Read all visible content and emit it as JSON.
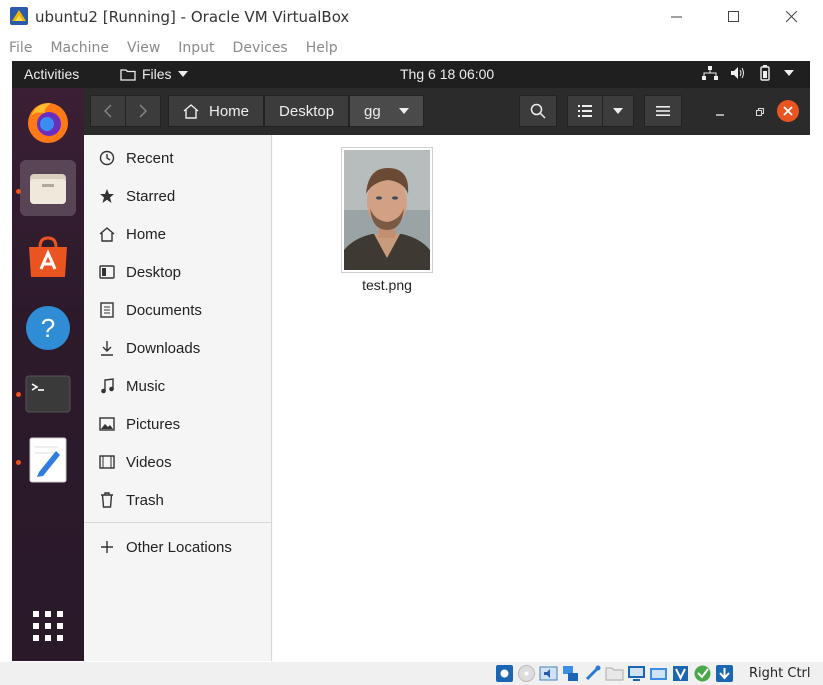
{
  "host": {
    "title": "ubuntu2 [Running] - Oracle VM VirtualBox",
    "menu": [
      "File",
      "Machine",
      "View",
      "Input",
      "Devices",
      "Help"
    ],
    "host_key": "Right Ctrl"
  },
  "ubuntu": {
    "activities": "Activities",
    "app_menu": "Files",
    "clock": "Thg 6 18  06:00"
  },
  "files": {
    "breadcrumbs": [
      "Home",
      "Desktop",
      "gg"
    ],
    "sidebar": [
      {
        "label": "Recent",
        "icon": "clock-icon"
      },
      {
        "label": "Starred",
        "icon": "star-icon"
      },
      {
        "label": "Home",
        "icon": "home-icon"
      },
      {
        "label": "Desktop",
        "icon": "desktop-icon"
      },
      {
        "label": "Documents",
        "icon": "document-icon"
      },
      {
        "label": "Downloads",
        "icon": "download-icon"
      },
      {
        "label": "Music",
        "icon": "music-icon"
      },
      {
        "label": "Pictures",
        "icon": "picture-icon"
      },
      {
        "label": "Videos",
        "icon": "video-icon"
      },
      {
        "label": "Trash",
        "icon": "trash-icon"
      }
    ],
    "other_locations": "Other Locations",
    "items": [
      {
        "name": "test.png"
      }
    ]
  },
  "colors": {
    "accent": "#e95420",
    "topbar": "#1f1f1f",
    "header": "#2b2b2b",
    "dock": "#2c1a2b"
  }
}
